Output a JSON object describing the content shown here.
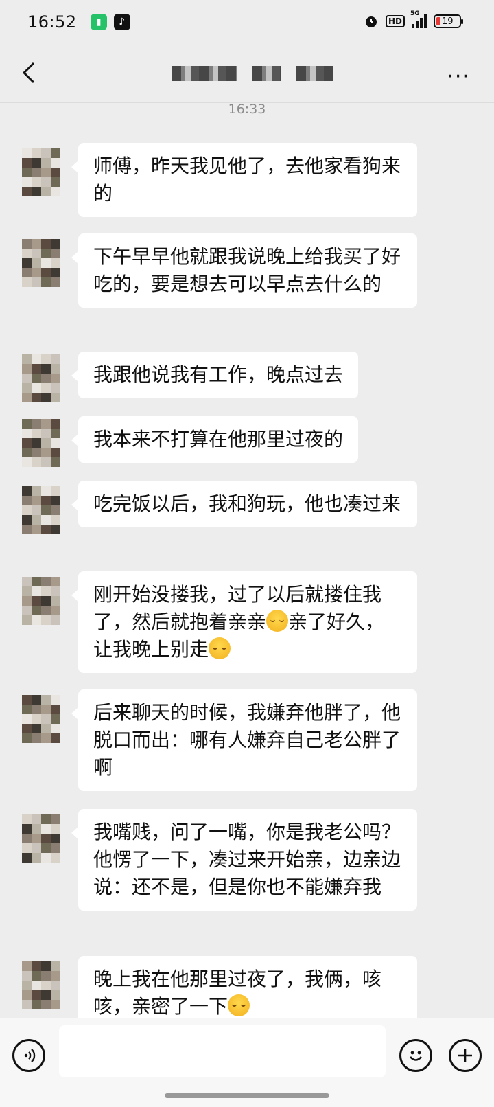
{
  "status": {
    "time": "16:52",
    "network": "5G",
    "hd": "HD",
    "battery": "19",
    "alarm_icon": "alarm-clock-icon"
  },
  "nav": {
    "back_icon": "chevron-left-icon",
    "more_icon": "more-dots-icon"
  },
  "chat": {
    "timestamp": "16:33",
    "messages": [
      {
        "text": "师傅，昨天我见他了，去他家看狗来的"
      },
      {
        "text": "下午早早他就跟我说晚上给我买了好吃的，要是想去可以早点去什么的"
      },
      {
        "text": "我跟他说我有工作，晚点过去"
      },
      {
        "text": "我本来不打算在他那里过夜的"
      },
      {
        "text": "吃完饭以后，我和狗玩，他也凑过来"
      },
      {
        "parts": [
          "刚开始没搂我，过了以后就搂住我了，然后就抱着亲亲",
          "亲了好久，让我晚上别走",
          ""
        ]
      },
      {
        "text": "后来聊天的时候，我嫌弃他胖了，他脱口而出：哪有人嫌弃自己老公胖了啊"
      },
      {
        "text": "我嘴贱，问了一嘴，你是我老公吗？他愣了一下，凑过来开始亲，边亲边说：还不是，但是你也不能嫌弃我"
      },
      {
        "parts": [
          "晚上我在他那里过夜了，我俩，咳咳，亲密了一下",
          ""
        ]
      }
    ]
  },
  "input": {
    "voice_icon": "voice-icon",
    "emoji_icon": "emoji-icon",
    "plus_icon": "plus-icon"
  }
}
